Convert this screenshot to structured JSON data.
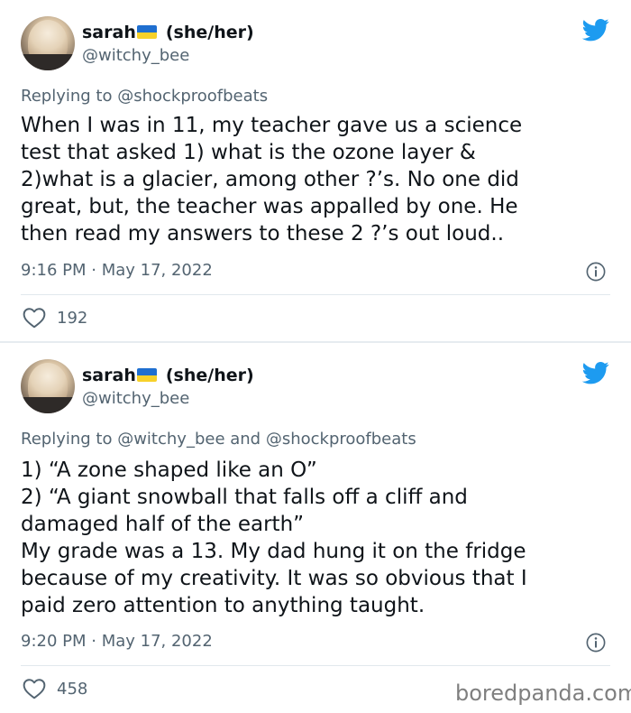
{
  "tweets": [
    {
      "display_name": "sarah",
      "pronouns": "(she/her)",
      "handle": "@witchy_bee",
      "replying_to": "Replying to @shockproofbeats",
      "body_lines": [
        "When I was in 11, my teacher gave us a science",
        "test that asked 1) what is the ozone layer &",
        "2)what is a glacier, among other ?’s. No one did",
        "great, but, the teacher was appalled by one. He",
        "then read my answers to these 2 ?’s out loud.."
      ],
      "timestamp": "9:16 PM · May 17, 2022",
      "likes": "192"
    },
    {
      "display_name": "sarah",
      "pronouns": "(she/her)",
      "handle": "@witchy_bee",
      "replying_to": "Replying to @witchy_bee and @shockproofbeats",
      "body_lines": [
        "1) “A zone shaped like an O”",
        "2) “A giant snowball that falls off a cliff and",
        "damaged half of the earth”",
        "My grade was a 13. My dad hung it on the fridge",
        "because of my creativity. It was so obvious that I",
        "paid zero attention to anything taught."
      ],
      "timestamp": "9:20 PM · May 17, 2022",
      "likes": "458"
    }
  ],
  "icons": {
    "bird": "twitter-bird-icon",
    "flag": "ukraine-flag-icon",
    "info": "info-icon",
    "heart": "heart-icon"
  },
  "colors": {
    "twitter_blue": "#1d9bf0",
    "secondary_text": "#536471",
    "flag_blue": "#1f6fd0",
    "flag_yellow": "#f7d12a"
  },
  "watermark": "boredpanda.com"
}
